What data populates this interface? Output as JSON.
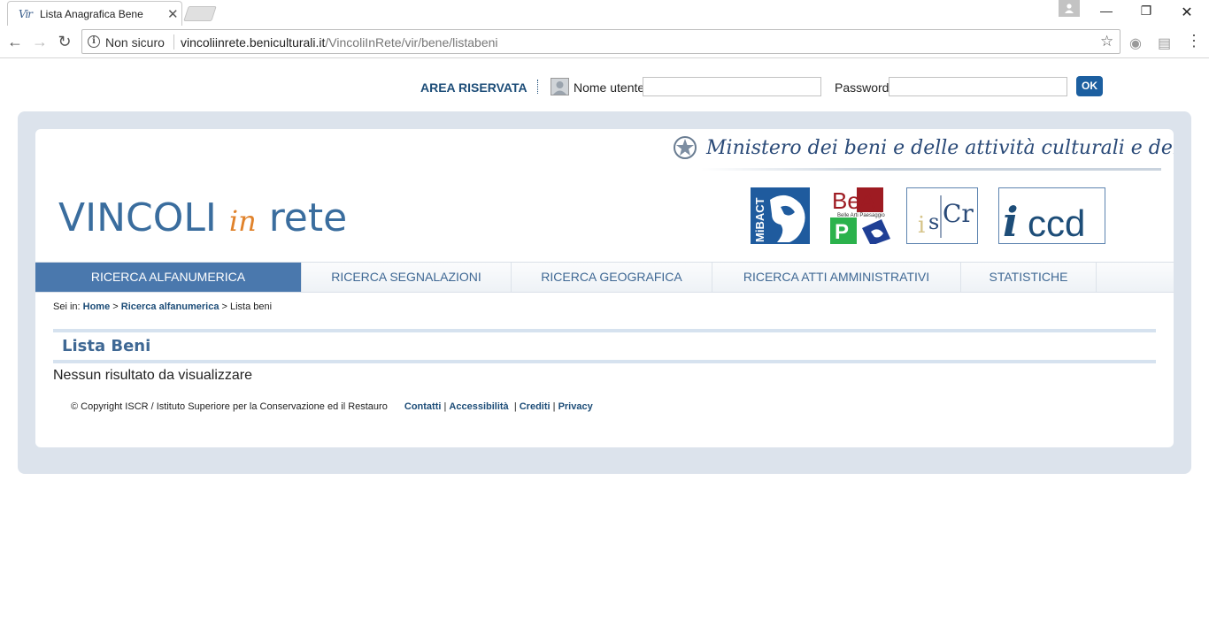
{
  "browser": {
    "tab_title": "Lista Anagrafica Bene",
    "tab_favicon": "Vir",
    "not_secure": "Non sicuro",
    "url_host": "vincoliinrete.beniculturali.it",
    "url_path": "/VincoliInRete/vir/bene/listabeni"
  },
  "login": {
    "area_label": "AREA RISERVATA",
    "username_label": "Nome utente",
    "password_label": "Password",
    "username_value": "",
    "password_value": "",
    "ok_label": "OK"
  },
  "header": {
    "ministero": "Ministero dei beni e delle attività culturali e del turismo",
    "brand_vincoli": "VINCOLI",
    "brand_in": "in",
    "brand_rete": "rete",
    "logos": {
      "mibact": "MiBACT",
      "bea_top": "BeA",
      "bea_sub": "Belle Arti Paesaggio",
      "bea_p": "P",
      "iscr_i": "i",
      "iscr_s": "s",
      "iscr_cr": "Cr",
      "iccd_i": "i",
      "iccd_ccd": "ccd"
    }
  },
  "nav": {
    "items": [
      {
        "label": "RICERCA ALFANUMERICA",
        "active": true
      },
      {
        "label": "RICERCA SEGNALAZIONI",
        "active": false
      },
      {
        "label": "RICERCA GEOGRAFICA",
        "active": false
      },
      {
        "label": "RICERCA ATTI AMMINISTRATIVI",
        "active": false
      },
      {
        "label": "STATISTICHE",
        "active": false
      }
    ]
  },
  "breadcrumb": {
    "prefix": "Sei in:",
    "home": "Home",
    "sep": ">",
    "section": "Ricerca alfanumerica",
    "current": "Lista beni"
  },
  "main": {
    "heading": "Lista Beni",
    "empty_message": "Nessun risultato da visualizzare"
  },
  "footer": {
    "copyright": "© Copyright ISCR / Istituto Superiore per la Conservazione ed il Restauro",
    "contatti": "Contatti",
    "accessibilita": "Accessibilità",
    "crediti": "Crediti",
    "privacy": "Privacy",
    "sep": "|"
  },
  "colors": {
    "accent": "#1d4d78",
    "nav_active": "#4a78ad",
    "frame": "#dce3ec",
    "brand_orange": "#e0822b"
  }
}
